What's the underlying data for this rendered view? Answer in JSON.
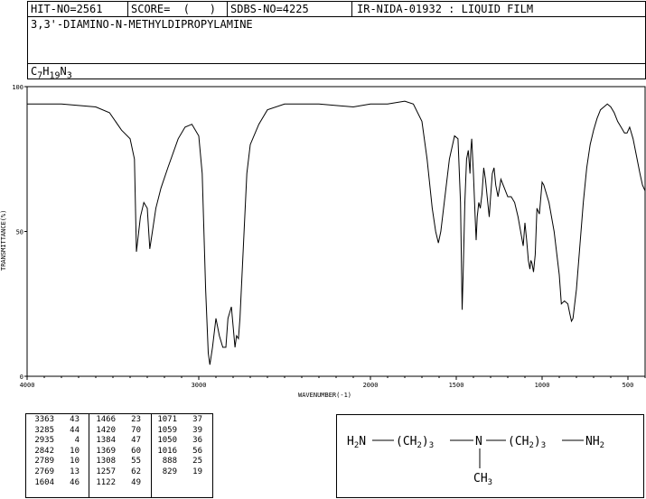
{
  "header": {
    "hit_no": "HIT-NO=2561",
    "score": "SCORE=  (   )",
    "sdbs_no": "SDBS-NO=4225",
    "source": "IR-NIDA-01932 : LIQUID FILM",
    "compound_name": "3,3'-DIAMINO-N-METHYLDIPROPYLAMINE",
    "formula": {
      "c": "C",
      "c_n": "7",
      "h": "H",
      "h_n": "19",
      "n": "N",
      "n_n": "3"
    }
  },
  "chart_data": {
    "type": "line",
    "xlabel": "WAVENUMBER(-1)",
    "ylabel": "TRANSMITTANCE(%)",
    "xlim": [
      4000,
      400
    ],
    "ylim": [
      0,
      100
    ],
    "x_ticks": [
      4000,
      3000,
      2000,
      1500,
      1000,
      500
    ],
    "y_ticks": [
      0,
      50,
      100
    ],
    "series": [
      {
        "points": [
          [
            4000,
            94
          ],
          [
            3800,
            94
          ],
          [
            3600,
            93
          ],
          [
            3520,
            91
          ],
          [
            3450,
            85
          ],
          [
            3400,
            82
          ],
          [
            3375,
            75
          ],
          [
            3363,
            43
          ],
          [
            3340,
            55
          ],
          [
            3320,
            60
          ],
          [
            3300,
            58
          ],
          [
            3285,
            44
          ],
          [
            3270,
            50
          ],
          [
            3250,
            58
          ],
          [
            3220,
            65
          ],
          [
            3180,
            72
          ],
          [
            3120,
            82
          ],
          [
            3080,
            86
          ],
          [
            3040,
            87
          ],
          [
            3000,
            83
          ],
          [
            2980,
            70
          ],
          [
            2960,
            30
          ],
          [
            2945,
            8
          ],
          [
            2935,
            4
          ],
          [
            2920,
            10
          ],
          [
            2900,
            20
          ],
          [
            2880,
            14
          ],
          [
            2860,
            10
          ],
          [
            2842,
            10
          ],
          [
            2830,
            20
          ],
          [
            2810,
            24
          ],
          [
            2789,
            10
          ],
          [
            2780,
            14
          ],
          [
            2769,
            13
          ],
          [
            2760,
            20
          ],
          [
            2740,
            45
          ],
          [
            2720,
            70
          ],
          [
            2700,
            80
          ],
          [
            2650,
            87
          ],
          [
            2600,
            92
          ],
          [
            2500,
            94
          ],
          [
            2300,
            94
          ],
          [
            2100,
            93
          ],
          [
            2000,
            94
          ],
          [
            1900,
            94
          ],
          [
            1800,
            95
          ],
          [
            1750,
            94
          ],
          [
            1700,
            88
          ],
          [
            1670,
            75
          ],
          [
            1640,
            58
          ],
          [
            1620,
            50
          ],
          [
            1604,
            46
          ],
          [
            1590,
            50
          ],
          [
            1570,
            60
          ],
          [
            1540,
            75
          ],
          [
            1510,
            83
          ],
          [
            1490,
            82
          ],
          [
            1475,
            60
          ],
          [
            1466,
            23
          ],
          [
            1460,
            35
          ],
          [
            1450,
            60
          ],
          [
            1440,
            75
          ],
          [
            1430,
            78
          ],
          [
            1420,
            70
          ],
          [
            1415,
            78
          ],
          [
            1410,
            82
          ],
          [
            1400,
            70
          ],
          [
            1390,
            55
          ],
          [
            1384,
            47
          ],
          [
            1378,
            55
          ],
          [
            1369,
            60
          ],
          [
            1360,
            58
          ],
          [
            1350,
            63
          ],
          [
            1340,
            72
          ],
          [
            1330,
            68
          ],
          [
            1320,
            62
          ],
          [
            1308,
            55
          ],
          [
            1300,
            62
          ],
          [
            1290,
            70
          ],
          [
            1280,
            72
          ],
          [
            1270,
            66
          ],
          [
            1257,
            62
          ],
          [
            1245,
            66
          ],
          [
            1240,
            68
          ],
          [
            1220,
            65
          ],
          [
            1200,
            62
          ],
          [
            1180,
            62
          ],
          [
            1160,
            60
          ],
          [
            1140,
            55
          ],
          [
            1122,
            49
          ],
          [
            1110,
            45
          ],
          [
            1100,
            53
          ],
          [
            1090,
            47
          ],
          [
            1080,
            40
          ],
          [
            1071,
            37
          ],
          [
            1065,
            40
          ],
          [
            1059,
            39
          ],
          [
            1050,
            36
          ],
          [
            1040,
            42
          ],
          [
            1030,
            58
          ],
          [
            1016,
            56
          ],
          [
            1010,
            60
          ],
          [
            1000,
            67
          ],
          [
            990,
            66
          ],
          [
            960,
            60
          ],
          [
            930,
            50
          ],
          [
            900,
            35
          ],
          [
            888,
            25
          ],
          [
            870,
            26
          ],
          [
            850,
            25
          ],
          [
            840,
            22
          ],
          [
            829,
            19
          ],
          [
            820,
            20
          ],
          [
            800,
            30
          ],
          [
            780,
            45
          ],
          [
            760,
            60
          ],
          [
            740,
            72
          ],
          [
            720,
            80
          ],
          [
            700,
            85
          ],
          [
            680,
            89
          ],
          [
            660,
            92
          ],
          [
            640,
            93
          ],
          [
            620,
            94
          ],
          [
            600,
            93
          ],
          [
            580,
            91
          ],
          [
            560,
            88
          ],
          [
            540,
            86
          ],
          [
            520,
            84
          ],
          [
            505,
            84
          ],
          [
            490,
            86
          ],
          [
            470,
            82
          ],
          [
            450,
            76
          ],
          [
            430,
            70
          ],
          [
            415,
            66
          ],
          [
            400,
            64
          ]
        ]
      }
    ],
    "peak_table": [
      [
        3363,
        43
      ],
      [
        3285,
        44
      ],
      [
        2935,
        4
      ],
      [
        2842,
        10
      ],
      [
        2789,
        10
      ],
      [
        2769,
        13
      ],
      [
        1604,
        46
      ],
      [
        1466,
        23
      ],
      [
        1420,
        70
      ],
      [
        1384,
        47
      ],
      [
        1369,
        60
      ],
      [
        1308,
        55
      ],
      [
        1257,
        62
      ],
      [
        1122,
        49
      ],
      [
        1071,
        37
      ],
      [
        1059,
        39
      ],
      [
        1050,
        36
      ],
      [
        1016,
        56
      ],
      [
        888,
        25
      ],
      [
        829,
        19
      ]
    ]
  },
  "structure": {
    "left_group": "H2N",
    "chain1": "(CH2)3",
    "center": "N",
    "chain2": "(CH2)3",
    "right_group": "NH2",
    "branch": "CH3"
  }
}
